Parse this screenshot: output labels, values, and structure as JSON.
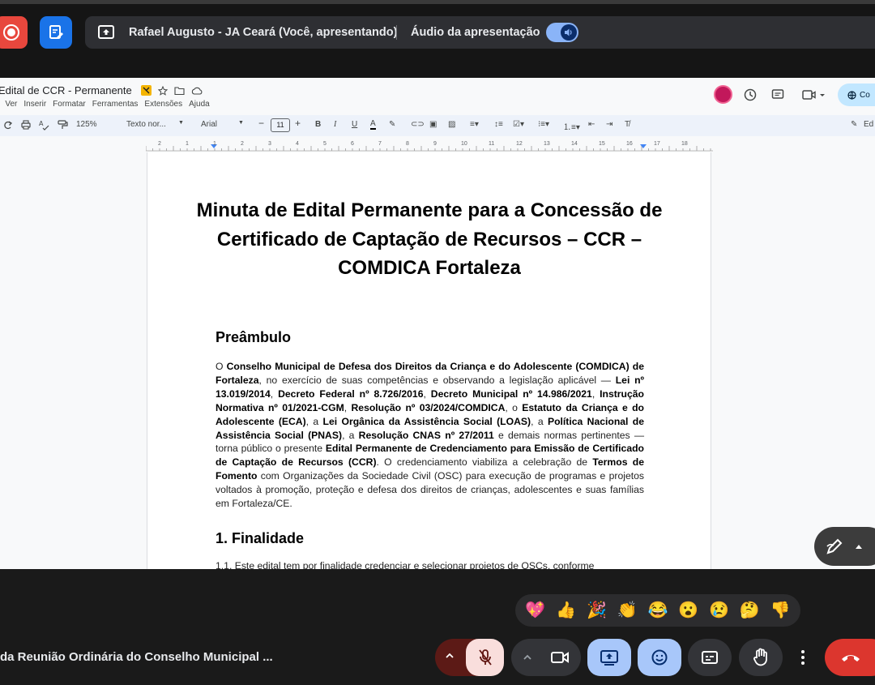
{
  "meet_bar": {
    "presenter_label": "Rafael Augusto - JA Ceará (Você, apresentando)",
    "audio_label": "Áudio da apresentação",
    "audio_enabled": true
  },
  "docs": {
    "title": "Edital de CCR - Permanente",
    "menu": [
      "r",
      "Ver",
      "Inserir",
      "Formatar",
      "Ferramentas",
      "Extensões",
      "Ajuda"
    ],
    "share_label": "Co",
    "toolbar": {
      "zoom": "125%",
      "style": "Texto nor...",
      "font": "Arial",
      "font_size": "11",
      "edit_mode": "Ed"
    },
    "ruler_numbers": [
      "2",
      "1",
      "1",
      "2",
      "3",
      "4",
      "5",
      "6",
      "7",
      "8",
      "9",
      "10",
      "11",
      "12",
      "13",
      "14",
      "15",
      "16",
      "17",
      "18"
    ]
  },
  "document": {
    "heading": "Minuta de Edital Permanente para a Concessão de Certificado de Captação de Recursos – CCR – COMDICA Fortaleza",
    "preambulo_title": "Preâmbulo",
    "preambulo_parts": [
      {
        "t": "O ",
        "b": false
      },
      {
        "t": "Conselho Municipal de Defesa dos Direitos da Criança e do Adolescente (COMDICA) de Fortaleza",
        "b": true
      },
      {
        "t": ", no exercício de suas competências e observando a legislação aplicável — ",
        "b": false
      },
      {
        "t": "Lei nº 13.019/2014",
        "b": true
      },
      {
        "t": ", ",
        "b": false
      },
      {
        "t": "Decreto Federal nº 8.726/2016",
        "b": true
      },
      {
        "t": ", ",
        "b": false
      },
      {
        "t": "Decreto Municipal nº 14.986/2021",
        "b": true
      },
      {
        "t": ", ",
        "b": false
      },
      {
        "t": "Instrução Normativa nº 01/2021-CGM",
        "b": true
      },
      {
        "t": ", ",
        "b": false
      },
      {
        "t": "Resolução nº 03/2024/COMDICA",
        "b": true
      },
      {
        "t": ", o ",
        "b": false
      },
      {
        "t": "Estatuto da Criança e do Adolescente (ECA)",
        "b": true
      },
      {
        "t": ", a ",
        "b": false
      },
      {
        "t": "Lei Orgânica da Assistência Social (LOAS)",
        "b": true
      },
      {
        "t": ", a ",
        "b": false
      },
      {
        "t": "Política Nacional de Assistência Social (PNAS)",
        "b": true
      },
      {
        "t": ", a ",
        "b": false
      },
      {
        "t": "Resolução CNAS nº 27/2011",
        "b": true
      },
      {
        "t": " e demais normas pertinentes — torna público o presente ",
        "b": false
      },
      {
        "t": "Edital Permanente de Credenciamento para Emissão de Certificado de Captação de Recursos (CCR)",
        "b": true
      },
      {
        "t": ". O credenciamento viabiliza a celebração de ",
        "b": false
      },
      {
        "t": "Termos de Fomento",
        "b": true
      },
      {
        "t": " com Organizações da Sociedade Civil (OSC) para execução de programas e projetos voltados à promoção, proteção e defesa dos direitos de crianças, adolescentes e suas famílias em Fortaleza/CE.",
        "b": false
      }
    ],
    "section1_title": "1. Finalidade",
    "section1_start": "1.1. Este edital tem por finalidade credenciar e selecionar projetos de OSCs, conforme"
  },
  "reactions": [
    "💖",
    "👍",
    "🎉",
    "👏",
    "😂",
    "😮",
    "😢",
    "🤔",
    "👎"
  ],
  "meeting_title": "da Reunião Ordinária do Conselho Municipal ...",
  "colors": {
    "end_call": "#dc362e",
    "accent": "#a8c7fa",
    "record": "#e8473d"
  }
}
